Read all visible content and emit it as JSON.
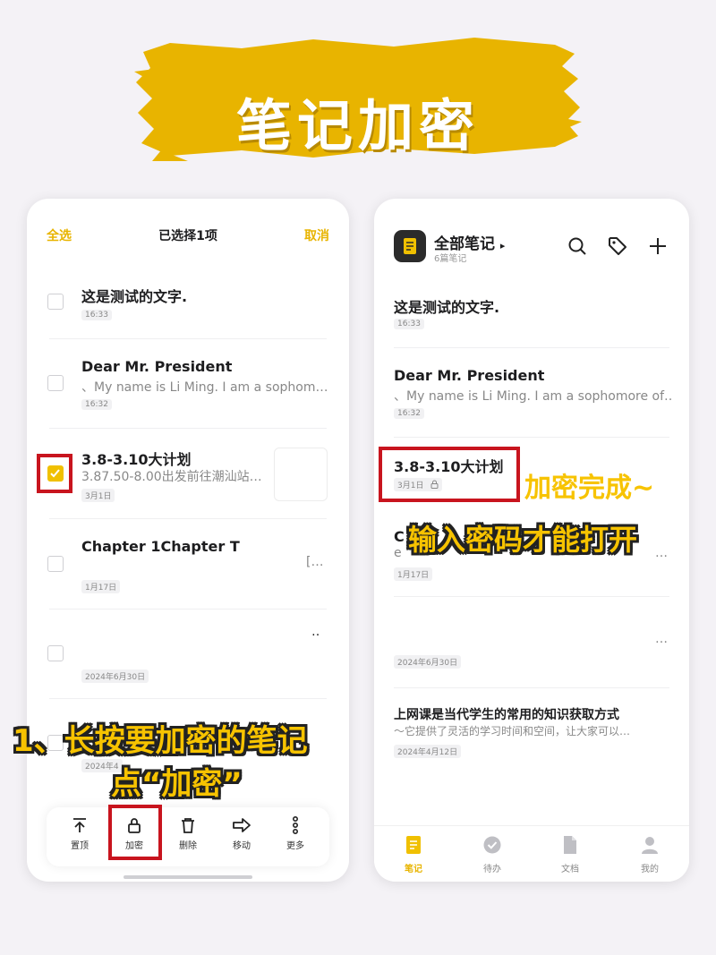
{
  "banner": {
    "title": "笔记加密",
    "color": "#e8b400"
  },
  "left": {
    "topbar": {
      "select_all": "全选",
      "title": "已选择1项",
      "cancel": "取消"
    },
    "notes": [
      {
        "title": "这是测试的文字.",
        "preview": "",
        "date": "16:33",
        "checked": false
      },
      {
        "title": "Dear Mr. President",
        "preview": "、My name is Li Ming. I am a sophom…",
        "date": "16:32",
        "checked": false
      },
      {
        "title": "3.8-3.10大计划",
        "preview": "3.87.50-8.00出发前往潮汕站…",
        "date": "3月1日",
        "checked": true
      },
      {
        "title": "Chapter 1Chapter T",
        "preview": "[…",
        "date": "1月17日",
        "checked": false
      },
      {
        "title": "",
        "preview": "‥",
        "date": "2024年6月30日",
        "checked": false
      },
      {
        "title": "",
        "preview": "",
        "date": "2024年4",
        "checked": false
      }
    ],
    "actions": [
      {
        "label": "置顶",
        "icon": "pin-top-icon"
      },
      {
        "label": "加密",
        "icon": "lock-icon"
      },
      {
        "label": "删除",
        "icon": "trash-icon"
      },
      {
        "label": "移动",
        "icon": "move-arrow-icon"
      },
      {
        "label": "更多",
        "icon": "more-dots-icon"
      }
    ]
  },
  "right": {
    "header": {
      "title": "全部笔记",
      "subtitle": "6篇笔记"
    },
    "notes": [
      {
        "title": "这是测试的文字.",
        "preview": "",
        "date": "16:33"
      },
      {
        "title": "Dear Mr. President",
        "preview": "、My name is Li Ming. I am a sophomore of…",
        "date": "16:32"
      },
      {
        "title": "3.8-3.10大计划",
        "preview": "",
        "date": "3月1日",
        "locked": true
      },
      {
        "title": "C",
        "preview": "e",
        "trailing": "…",
        "date": "1月17日"
      },
      {
        "title": "",
        "preview": "",
        "trailing": "…",
        "date": "2024年6月30日"
      },
      {
        "title": "上网课是当代学生的常用的知识获取方式",
        "preview": "～它提供了灵活的学习时间和空间，让大家可以…",
        "date": "2024年4月12日"
      }
    ],
    "tabs": [
      {
        "label": "笔记",
        "icon": "note-tab-icon",
        "active": true
      },
      {
        "label": "待办",
        "icon": "todo-tab-icon",
        "active": false
      },
      {
        "label": "文档",
        "icon": "document-tab-icon",
        "active": false
      },
      {
        "label": "我的",
        "icon": "profile-tab-icon",
        "active": false
      }
    ]
  },
  "overlays": {
    "step1_line1": "1、长按要加密的笔记",
    "step1_line2": "点“加密”",
    "done_line1": "加密完成~",
    "done_line2": "输入密码才能打开"
  },
  "colors": {
    "accent": "#f0c000",
    "highlight_box": "#c8141e"
  }
}
